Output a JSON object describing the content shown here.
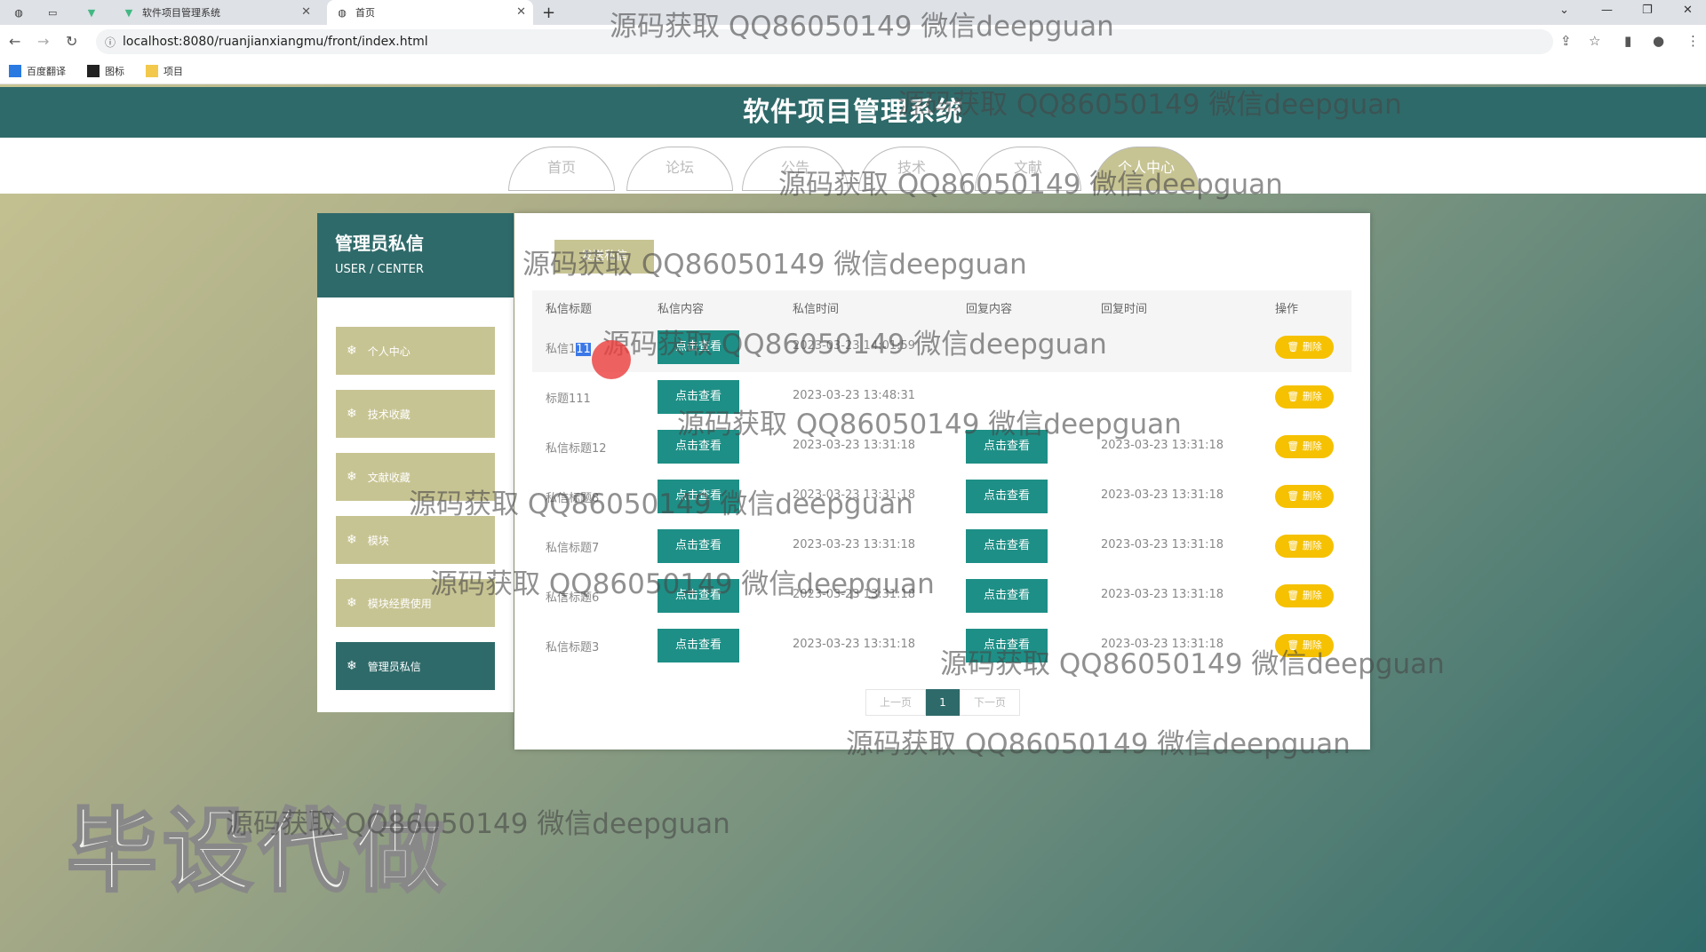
{
  "browser": {
    "tabs": [
      {
        "title": ""
      },
      {
        "title": ""
      },
      {
        "title": ""
      },
      {
        "title": "软件项目管理系统"
      },
      {
        "title": "首页"
      }
    ],
    "url": "localhost:8080/ruanjianxiangmu/front/index.html",
    "bookmarks": [
      "百度翻译",
      "图标",
      "项目"
    ]
  },
  "site": {
    "title": "软件项目管理系统",
    "nav": [
      "首页",
      "论坛",
      "公告",
      "技术",
      "文献",
      "个人中心"
    ],
    "active_nav_index": 5
  },
  "sidebar": {
    "title": "管理员私信",
    "subtitle": "USER / CENTER",
    "items": [
      "个人中心",
      "技术收藏",
      "文献收藏",
      "模块",
      "模块经费使用",
      "管理员私信"
    ],
    "active_index": 5
  },
  "content": {
    "send_button": "发送私信",
    "columns": [
      "私信标题",
      "私信内容",
      "私信时间",
      "回复内容",
      "回复时间",
      "操作"
    ],
    "view_label": "点击查看",
    "delete_label": "删除",
    "rows": [
      {
        "title_prefix": "私信1",
        "title_selected": "11",
        "time": "2023-03-23 14:01:59",
        "reply_time": "",
        "has_reply": false
      },
      {
        "title": "标题111",
        "time": "2023-03-23 13:48:31",
        "reply_time": "",
        "has_reply": false
      },
      {
        "title": "私信标题12",
        "time": "2023-03-23 13:31:18",
        "reply_time": "2023-03-23 13:31:18",
        "has_reply": true
      },
      {
        "title": "私信标题8",
        "time": "2023-03-23 13:31:18",
        "reply_time": "2023-03-23 13:31:18",
        "has_reply": true
      },
      {
        "title": "私信标题7",
        "time": "2023-03-23 13:31:18",
        "reply_time": "2023-03-23 13:31:18",
        "has_reply": true
      },
      {
        "title": "私信标题6",
        "time": "2023-03-23 13:31:18",
        "reply_time": "2023-03-23 13:31:18",
        "has_reply": true
      },
      {
        "title": "私信标题3",
        "time": "2023-03-23 13:31:18",
        "reply_time": "2023-03-23 13:31:18",
        "has_reply": true
      }
    ],
    "pager": {
      "prev": "上一页",
      "current": "1",
      "next": "下一页"
    }
  },
  "overlay": {
    "banner": "毕设代做",
    "watermark": "源码获取 QQ86050149 微信deepguan"
  }
}
